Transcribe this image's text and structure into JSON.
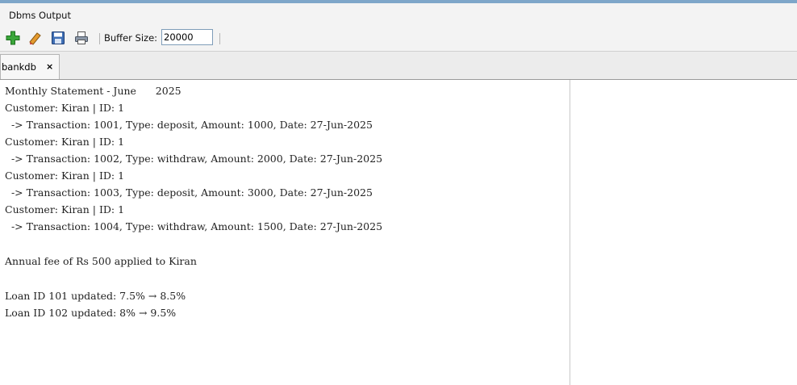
{
  "panel": {
    "title": "Dbms Output"
  },
  "toolbar": {
    "icons": [
      "add-icon",
      "eraser-icon",
      "save-icon",
      "print-icon"
    ],
    "buffer_label": "Buffer Size:",
    "buffer_value": "20000"
  },
  "tabs": [
    {
      "label": "bankdb",
      "close": "×"
    }
  ],
  "output": {
    "lines": [
      "Monthly Statement - June      2025",
      "Customer: Kiran | ID: 1",
      "  -> Transaction: 1001, Type: deposit, Amount: 1000, Date: 27-Jun-2025",
      "Customer: Kiran | ID: 1",
      "  -> Transaction: 1002, Type: withdraw, Amount: 2000, Date: 27-Jun-2025",
      "Customer: Kiran | ID: 1",
      "  -> Transaction: 1003, Type: deposit, Amount: 3000, Date: 27-Jun-2025",
      "Customer: Kiran | ID: 1",
      "  -> Transaction: 1004, Type: withdraw, Amount: 1500, Date: 27-Jun-2025",
      "",
      "Annual fee of Rs 500 applied to Kiran",
      "",
      "Loan ID 101 updated: 7.5% → 8.5%",
      "Loan ID 102 updated: 8% → 9.5%"
    ]
  },
  "colors": {
    "accent_strip": "#7ea6c9",
    "add_icon": "#2e9b2e"
  }
}
